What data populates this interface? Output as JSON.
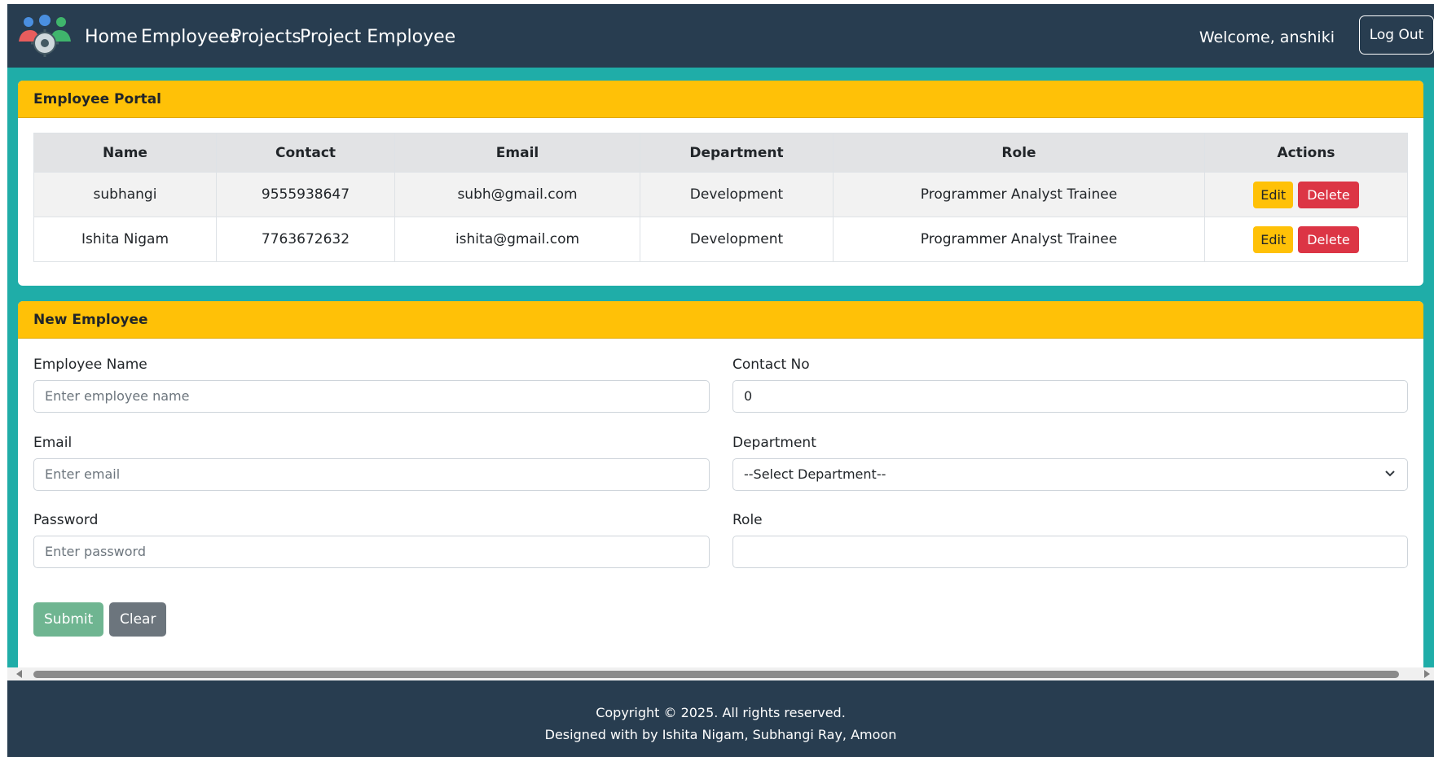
{
  "nav": {
    "links": [
      "Home",
      "Employees",
      "Projects",
      "Project Employee"
    ],
    "welcome": "Welcome, anshiki",
    "logout": "Log Out"
  },
  "portal": {
    "title": "Employee Portal",
    "columns": [
      "Name",
      "Contact",
      "Email",
      "Department",
      "Role",
      "Actions"
    ],
    "rows": [
      {
        "name": "subhangi",
        "contact": "9555938647",
        "email": "subh@gmail.com",
        "department": "Development",
        "role": "Programmer Analyst Trainee"
      },
      {
        "name": "Ishita Nigam",
        "contact": "7763672632",
        "email": "ishita@gmail.com",
        "department": "Development",
        "role": "Programmer Analyst Trainee"
      }
    ],
    "edit_label": "Edit",
    "delete_label": "Delete"
  },
  "form": {
    "title": "New Employee",
    "name_label": "Employee Name",
    "name_placeholder": "Enter employee name",
    "contact_label": "Contact No",
    "contact_value": "0",
    "email_label": "Email",
    "email_placeholder": "Enter email",
    "department_label": "Department",
    "department_selected": "--Select Department--",
    "password_label": "Password",
    "password_placeholder": "Enter password",
    "role_label": "Role",
    "role_value": "",
    "submit_label": "Submit",
    "clear_label": "Clear"
  },
  "footer": {
    "copyright": "Copyright © 2025. All rights reserved.",
    "designed": "Designed with by Ishita Nigam, Subhangi Ray, Amoon"
  },
  "colors": {
    "navbar": "#283d50",
    "teal": "#1fada8",
    "header_yellow": "#ffc107",
    "delete_red": "#dc3545",
    "submit_green": "#6fb591",
    "clear_gray": "#6c757d"
  }
}
